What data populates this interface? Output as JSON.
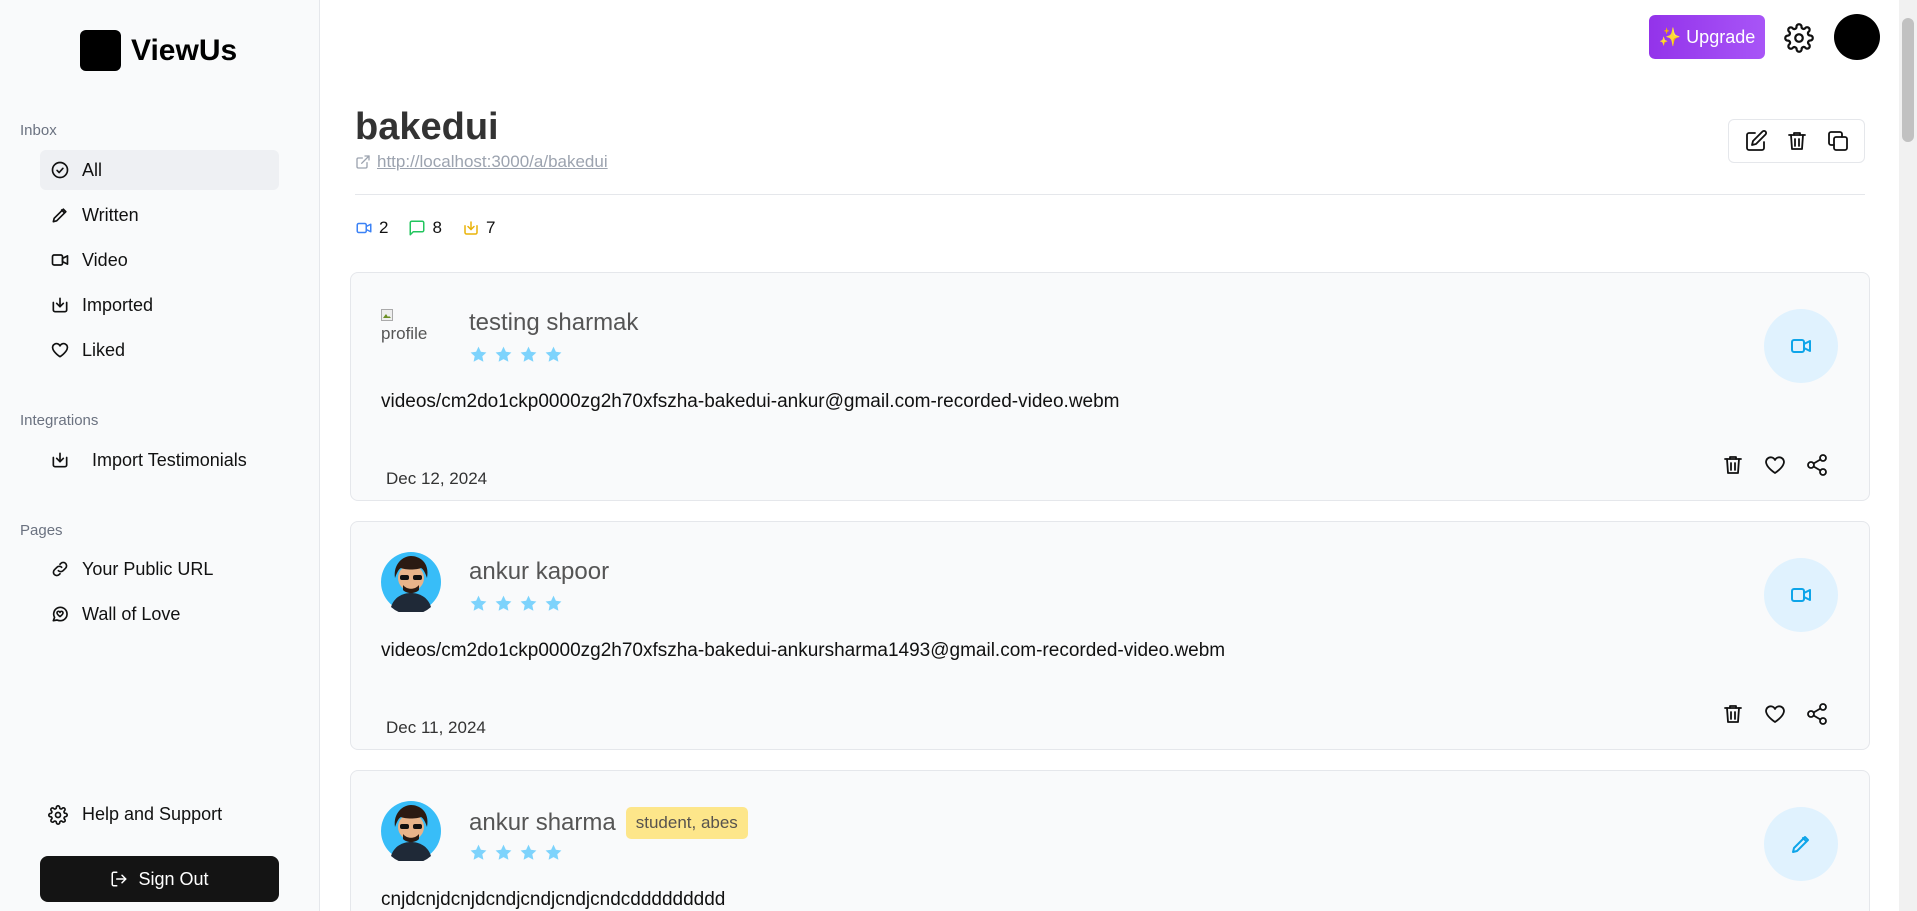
{
  "app": {
    "name": "ViewUs"
  },
  "sidebar": {
    "sections": {
      "inbox": "Inbox",
      "integrations": "Integrations",
      "pages": "Pages"
    },
    "inbox_items": [
      {
        "label": "All",
        "icon": "check-circle-icon",
        "active": true
      },
      {
        "label": "Written",
        "icon": "pencil-icon"
      },
      {
        "label": "Video",
        "icon": "video-icon"
      },
      {
        "label": "Imported",
        "icon": "import-icon"
      },
      {
        "label": "Liked",
        "icon": "heart-icon"
      }
    ],
    "integration_items": [
      {
        "label": "Import Testimonials",
        "icon": "import-icon"
      }
    ],
    "page_items": [
      {
        "label": "Your Public URL",
        "icon": "link-icon"
      },
      {
        "label": "Wall of Love",
        "icon": "heart-chat-icon"
      }
    ],
    "help": "Help and Support",
    "sign_out": "Sign Out"
  },
  "topbar": {
    "upgrade": "✨ Upgrade"
  },
  "space": {
    "title": "bakedui",
    "url": "http://localhost:3000/a/bakedui",
    "counts": {
      "video": "2",
      "written": "8",
      "imported": "7"
    },
    "colors": {
      "video": "#3b82f6",
      "written": "#22c55e",
      "imported": "#eab308"
    }
  },
  "testimonials": [
    {
      "name": "testing sharmak",
      "avatar": "broken",
      "avatar_alt": "profile",
      "rating": 4,
      "text": "videos/cm2do1ckp0000zg2h70xfszha-bakedui-ankur@gmail.com-recorded-video.webm",
      "date": "Dec 12, 2024",
      "type": "video"
    },
    {
      "name": "ankur kapoor",
      "avatar": "cartoon",
      "rating": 4,
      "text": "videos/cm2do1ckp0000zg2h70xfszha-bakedui-ankursharma1493@gmail.com-recorded-video.webm",
      "date": "Dec 11, 2024",
      "type": "video"
    },
    {
      "name": "ankur sharma",
      "tag": "student, abes",
      "avatar": "cartoon",
      "rating": 4,
      "text": "cnjdcnjdcnjdcndjcndjcndjcndcddddddddd",
      "type": "written"
    }
  ],
  "colors": {
    "star": "#7dd3fc",
    "accent": "#0ea5e9",
    "upgrade": "#a855f7"
  }
}
